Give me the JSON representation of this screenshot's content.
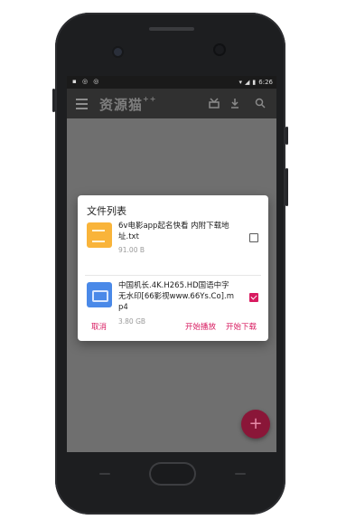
{
  "status_bar": {
    "left_icons": "▪ ◎ ◎",
    "time": "6:26"
  },
  "app_bar": {
    "logo_text": "资源猫",
    "logo_suffix": "++",
    "icons": [
      "menu-icon",
      "logo",
      "tv-icon",
      "download-icon",
      "search-icon"
    ]
  },
  "dialog": {
    "title": "文件列表",
    "files": [
      {
        "name": "6v电影app起名快看 内附下载地址.txt",
        "size": "91.00 B",
        "checked": false,
        "type": "txt",
        "color": "#f9b43a"
      },
      {
        "name": "中国机长.4K.H265.HD国语中字无水印[66影视www.66Ys.Co].mp4",
        "size": "3.80 GB",
        "checked": true,
        "type": "mp4",
        "color": "#4a89e8"
      }
    ],
    "actions": {
      "cancel": "取消",
      "play": "开始播放",
      "download": "开始下载"
    }
  },
  "fab": {
    "label": "+",
    "color": "#8a1638"
  },
  "colors": {
    "accent": "#d81b60",
    "app_bar": "#303030",
    "scrim": "#6f6f6f"
  }
}
